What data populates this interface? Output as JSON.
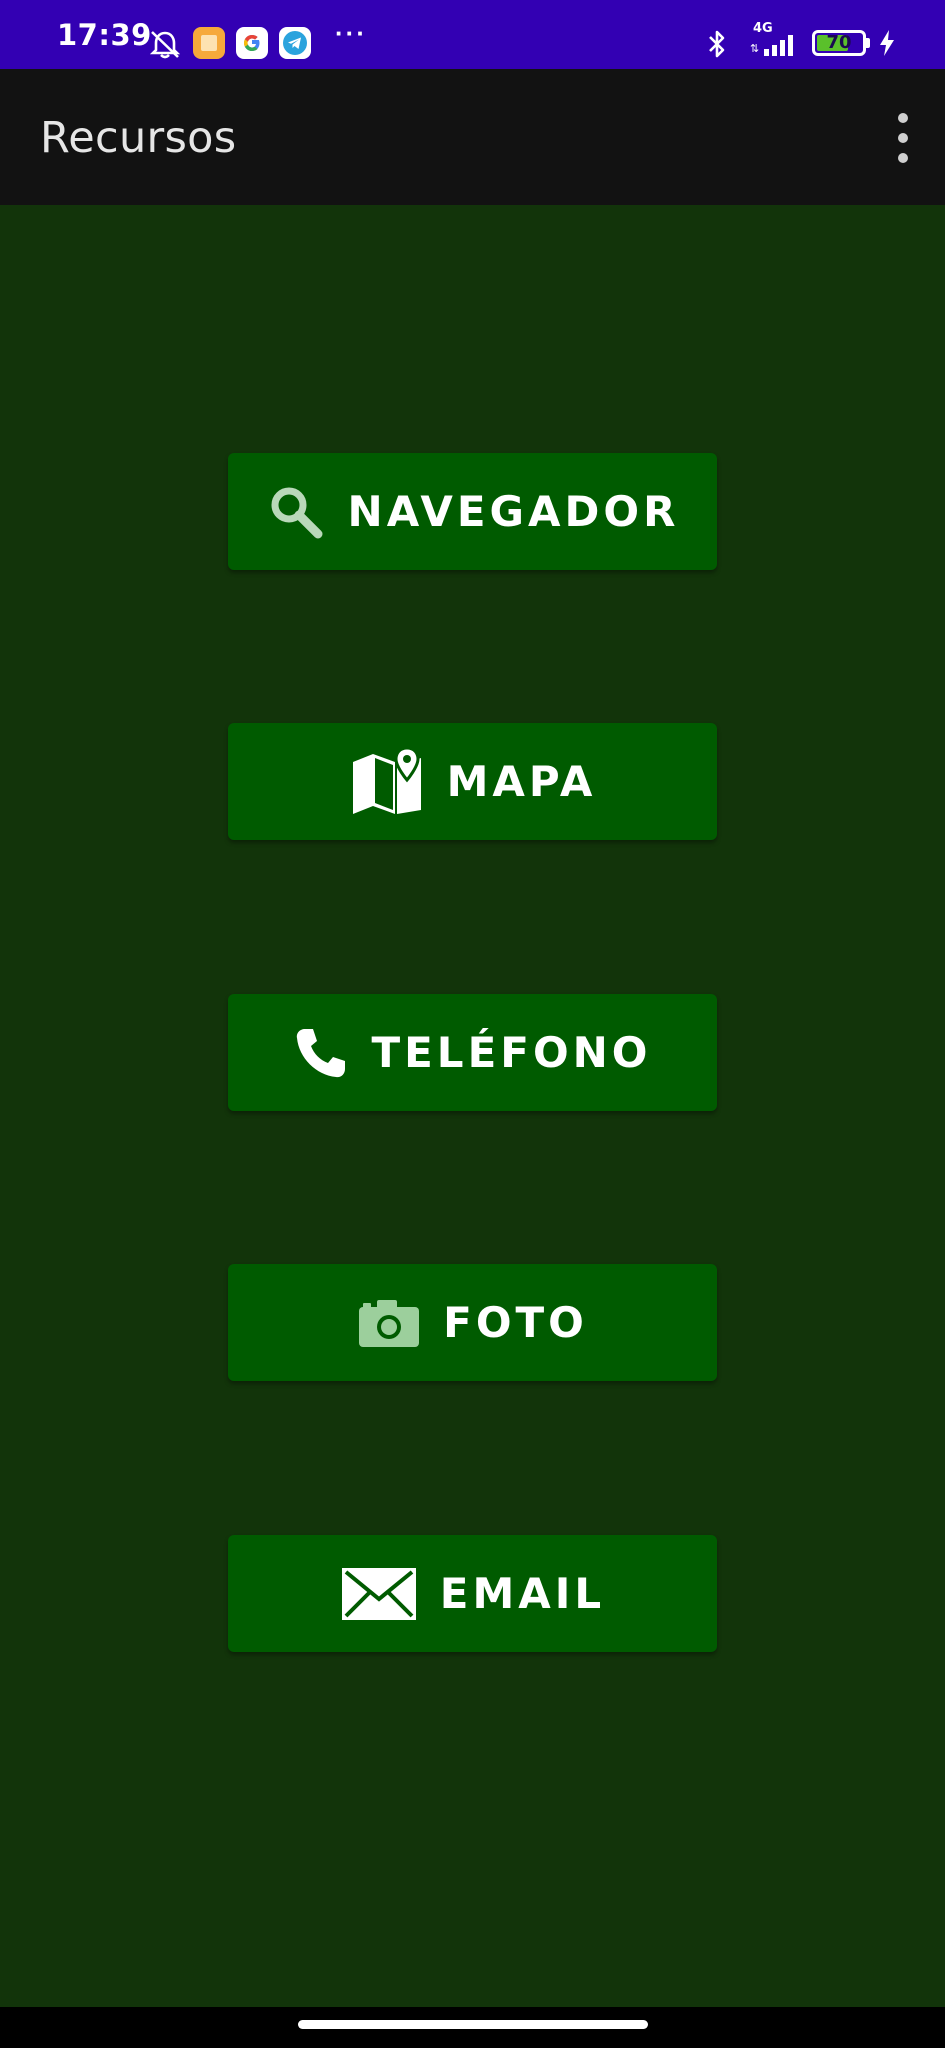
{
  "status_bar": {
    "time": "17:39",
    "more": "···",
    "network": "4G",
    "battery_level": "70",
    "battery_fraction": 0.7,
    "icons": [
      "muted-alarm-icon",
      "notes-app-icon",
      "google-app-icon",
      "telegram-app-icon",
      "bluetooth-icon",
      "signal-icon",
      "battery-icon",
      "charging-icon"
    ]
  },
  "app_bar": {
    "title": "Recursos",
    "menu_icon": "overflow-menu-icon"
  },
  "colors": {
    "status_bar": "#3300b3",
    "app_bar": "#121212",
    "background": "#12340a",
    "button": "#005b00",
    "text": "#ffffff"
  },
  "buttons": [
    {
      "label": "NAVEGADOR",
      "icon": "search-icon"
    },
    {
      "label": "MAPA",
      "icon": "map-icon"
    },
    {
      "label": "TELÉFONO",
      "icon": "phone-icon"
    },
    {
      "label": "FOTO",
      "icon": "camera-icon"
    },
    {
      "label": "EMAIL",
      "icon": "email-icon"
    }
  ]
}
